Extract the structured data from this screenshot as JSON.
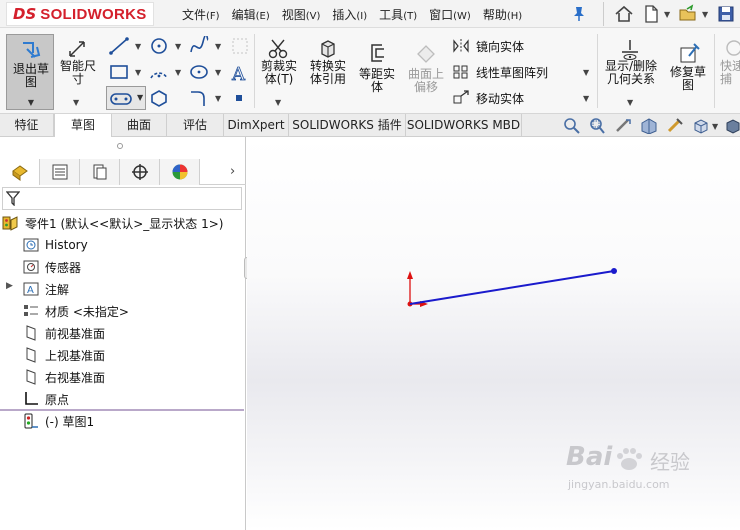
{
  "app": {
    "logo_mark": "DS",
    "logo_text": "SOLIDWORKS"
  },
  "menu": [
    {
      "label": "文件",
      "accel": "(F)"
    },
    {
      "label": "编辑",
      "accel": "(E)"
    },
    {
      "label": "视图",
      "accel": "(V)"
    },
    {
      "label": "插入",
      "accel": "(I)"
    },
    {
      "label": "工具",
      "accel": "(T)"
    },
    {
      "label": "窗口",
      "accel": "(W)"
    },
    {
      "label": "帮助",
      "accel": "(H)"
    }
  ],
  "ribbon": {
    "exit_sketch": {
      "line1": "退出草",
      "line2": "图"
    },
    "smart_dim": {
      "line1": "智能尺",
      "line2": "寸"
    },
    "trim": {
      "line1": "剪裁实",
      "line2": "体(T)"
    },
    "convert": {
      "line1": "转换实",
      "line2": "体引用"
    },
    "offset": {
      "line1": "等距实",
      "line2": "体"
    },
    "surface_offset": {
      "line1": "曲面上",
      "line2": "偏移"
    },
    "mirror": "镜向实体",
    "linear_pattern": "线性草图阵列",
    "move": "移动实体",
    "show_relations": {
      "line1": "显示/删除",
      "line2": "几何关系"
    },
    "repair": {
      "line1": "修复草",
      "line2": "图"
    },
    "quick_snaps": {
      "line1": "快速",
      "line2": "捕"
    }
  },
  "tabs": [
    "特征",
    "草图",
    "曲面",
    "评估",
    "DimXpert",
    "SOLIDWORKS 插件",
    "SOLIDWORKS MBD"
  ],
  "active_tab": "草图",
  "tree": {
    "root": "零件1  (默认<<默认>_显示状态 1>)",
    "items": [
      "History",
      "传感器",
      "注解",
      "材质 <未指定>",
      "前视基准面",
      "上视基准面",
      "右视基准面",
      "原点",
      "(-) 草图1"
    ]
  },
  "watermark": {
    "brand": "Bai",
    "brand2": "经验",
    "url": "jingyan.baidu.com"
  },
  "colors": {
    "brand_red": "#d4202c",
    "sketch_line": "#1a1acc",
    "origin_red": "#dd1111"
  }
}
